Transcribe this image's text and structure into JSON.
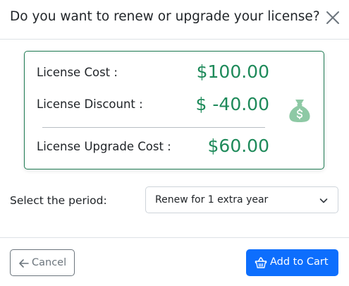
{
  "dialog": {
    "title": "Do you want to renew or upgrade your license?",
    "close_icon": "close-icon"
  },
  "costs": {
    "license_cost_label": "License Cost :",
    "license_cost_value": "$100.00",
    "license_discount_label": "License Discount :",
    "license_discount_value": "$ -40.00",
    "upgrade_cost_label": "License Upgrade Cost :",
    "upgrade_cost_value": "$60.00",
    "icon": "money-bag-icon"
  },
  "period": {
    "label": "Select the period:",
    "selected": "Renew for 1 extra year"
  },
  "footer": {
    "cancel_label": "Cancel",
    "cancel_icon": "arrow-left-icon",
    "add_to_cart_label": "Add to Cart",
    "add_to_cart_icon": "basket-icon"
  },
  "colors": {
    "accent_green": "#1e8a5a",
    "card_border": "#1e7a52",
    "primary_blue": "#0d6efd",
    "secondary_gray": "#6c757d",
    "money_bag": "#8ec9a5"
  }
}
